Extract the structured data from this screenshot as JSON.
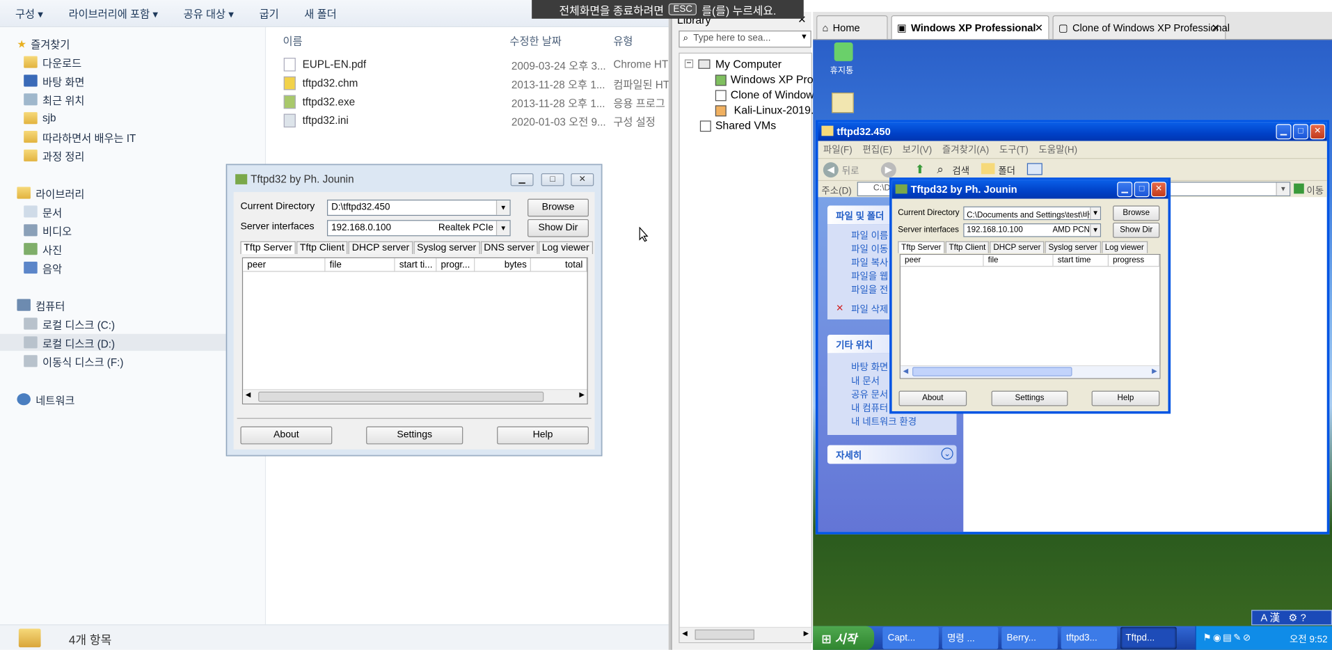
{
  "explorer": {
    "toolbar": [
      "구성 ▾",
      "라이브러리에 포함 ▾",
      "공유 대상 ▾",
      "굽기",
      "새 폴더"
    ],
    "nav": {
      "favorites": "즐겨찾기",
      "fav_items": [
        "다운로드",
        "바탕 화면",
        "최근 위치",
        "sjb",
        "따라하면서 배우는 IT",
        "과정 정리"
      ],
      "libraries": "라이브러리",
      "lib_items": [
        "문서",
        "비디오",
        "사진",
        "음악"
      ],
      "computer": "컴퓨터",
      "comp_items": [
        "로컬 디스크 (C:)",
        "로컬 디스크 (D:)",
        "이동식 디스크 (F:)"
      ],
      "network": "네트워크"
    },
    "columns": {
      "name": "이름",
      "modified": "수정한 날짜",
      "type": "유형"
    },
    "files": [
      {
        "name": "EUPL-EN.pdf",
        "date": "2009-03-24 오후 3...",
        "type": "Chrome HT"
      },
      {
        "name": "tftpd32.chm",
        "date": "2013-11-28 오후 1...",
        "type": "컴파일된 HT"
      },
      {
        "name": "tftpd32.exe",
        "date": "2013-11-28 오후 1...",
        "type": "응용 프로그"
      },
      {
        "name": "tftpd32.ini",
        "date": "2020-01-03 오전 9...",
        "type": "구성 설정"
      }
    ],
    "status": "4개 항목"
  },
  "banner": {
    "pre": "전체화면을 종료하려면",
    "key": "ESC",
    "post": "를(를) 누르세요."
  },
  "tftpd_host": {
    "title": "Tftpd32 by Ph. Jounin",
    "cur_dir_label": "Current Directory",
    "cur_dir_value": "D:\\tftpd32.450",
    "iface_label": "Server interfaces",
    "iface_ip": "192.168.0.100",
    "iface_nic": "Realtek PCIe",
    "browse": "Browse",
    "showdir": "Show Dir",
    "tabs": [
      "Tftp Server",
      "Tftp Client",
      "DHCP server",
      "Syslog server",
      "DNS server",
      "Log viewer"
    ],
    "cols": [
      "peer",
      "file",
      "start ti...",
      "progr...",
      "bytes",
      "total"
    ],
    "about": "About",
    "settings": "Settings",
    "help": "Help"
  },
  "vmware": {
    "library_title": "Library",
    "search_placeholder": "Type here to sea...",
    "tree": {
      "root": "My Computer",
      "vms": [
        "Windows XP Pro",
        "Clone of Window",
        "Kali-Linux-2019."
      ],
      "shared": "Shared VMs"
    },
    "tabs": [
      "Home",
      "Windows XP Professional",
      "Clone of Windows XP Professional"
    ]
  },
  "guest": {
    "recycle": "휴지통",
    "explorer_title": "tftpd32.450",
    "menu": [
      "파일(F)",
      "편집(E)",
      "보기(V)",
      "즐겨찾기(A)",
      "도구(T)",
      "도움말(H)"
    ],
    "back": "뒤로",
    "search": "검색",
    "folders": "폴더",
    "address_label": "주소(D)",
    "address_value": "C:\\Do",
    "go": "이동",
    "panel_file": "파일 및 폴더",
    "file_tasks": [
      "파일 이름",
      "파일 이동",
      "파일 복사",
      "파일을 웹",
      "파일을 전",
      "파일 삭제"
    ],
    "panel_other": "기타 위치",
    "other_places": [
      "바탕 화면",
      "내 문서",
      "공유 문서",
      "내 컴퓨터",
      "내 네트워크 환경"
    ],
    "panel_detail": "자세히",
    "tftpd": {
      "title": "Tftpd32 by Ph. Jounin",
      "cur_dir_label": "Current Directory",
      "cur_dir_value": "C:\\Documents and Settings\\test\\바탕",
      "iface_label": "Server interfaces",
      "iface_ip": "192.168.10.100",
      "iface_nic": "AMD PCNE",
      "browse": "Browse",
      "showdir": "Show Dir",
      "tabs": [
        "Tftp Server",
        "Tftp Client",
        "DHCP server",
        "Syslog server",
        "Log viewer"
      ],
      "cols": [
        "peer",
        "file",
        "start time",
        "progress"
      ],
      "about": "About",
      "settings": "Settings",
      "help": "Help"
    },
    "lang": "A 漢",
    "taskbar": {
      "start": "시작",
      "items": [
        "Capt...",
        "명령 ...",
        "Berry...",
        "tftpd3...",
        "Tftpd..."
      ],
      "clock": "오전 9:52"
    }
  },
  "colors": {
    "xp_blue": "#0054e3",
    "xp_start": "#3c9a3c",
    "aero_frame": "#dce7f3"
  }
}
